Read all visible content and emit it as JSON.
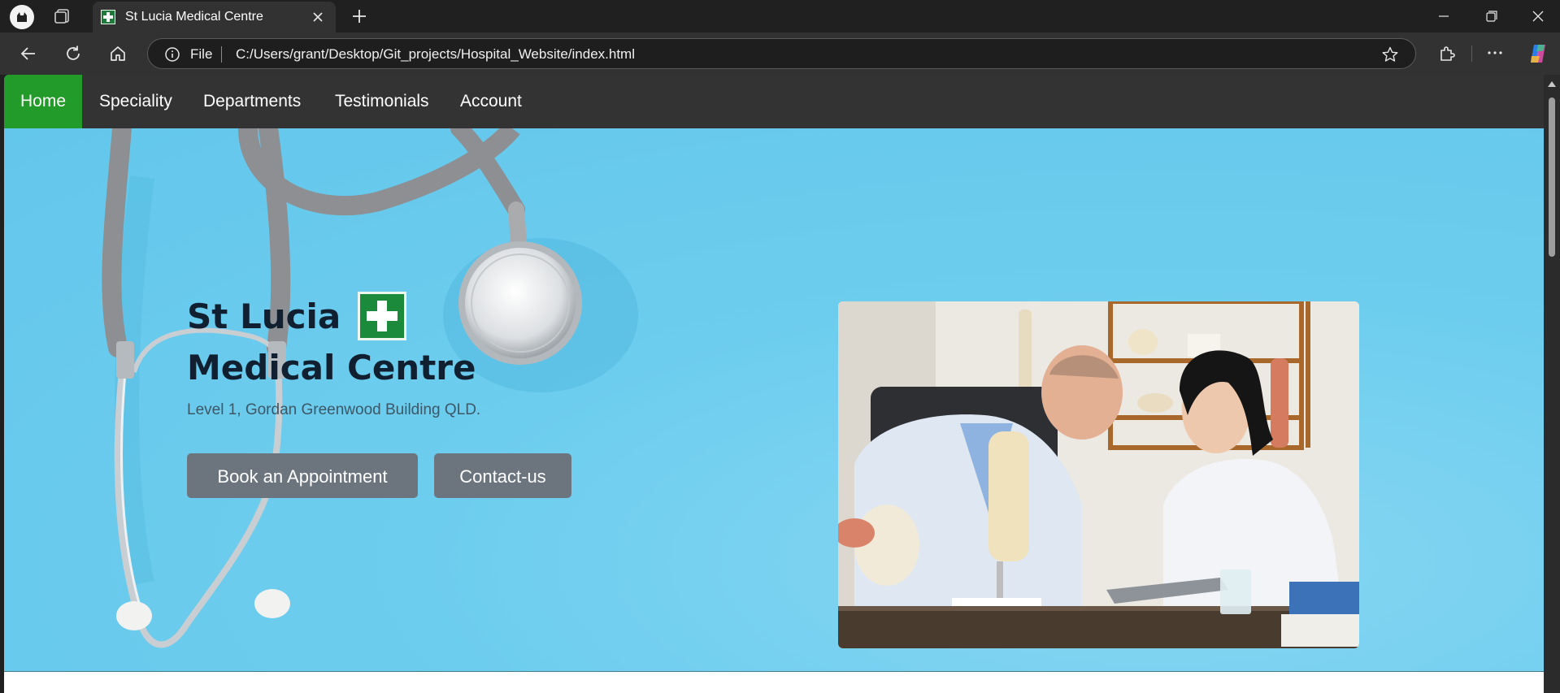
{
  "browser": {
    "tab_title": "St Lucia Medical Centre",
    "address_prefix": "File",
    "url": "C:/Users/grant/Desktop/Git_projects/Hospital_Website/index.html"
  },
  "site": {
    "nav": {
      "items": [
        {
          "label": "Home",
          "active": true
        },
        {
          "label": "Speciality",
          "active": false
        },
        {
          "label": "Departments",
          "active": false
        },
        {
          "label": "Testimonials",
          "active": false
        },
        {
          "label": "Account",
          "active": false
        }
      ],
      "active_color": "#239b2a"
    },
    "hero": {
      "title_line1": "St Lucia",
      "title_line2": "Medical Centre",
      "address": "Level 1, Gordan Greenwood Building QLD.",
      "book_button": "Book an Appointment",
      "contact_button": "Contact-us",
      "background_color": "#63c6eb",
      "button_color": "#6c757d"
    }
  },
  "icons": [
    "profile-icon",
    "workspaces-icon",
    "tab-favicon",
    "close-icon",
    "plus-icon",
    "minimize-icon",
    "maximize-icon",
    "close-window-icon",
    "back-icon",
    "reload-icon",
    "home-icon",
    "info-icon",
    "star-icon",
    "extensions-icon",
    "more-icon",
    "copilot-icon",
    "medical-cross-icon",
    "stethoscope-image"
  ]
}
